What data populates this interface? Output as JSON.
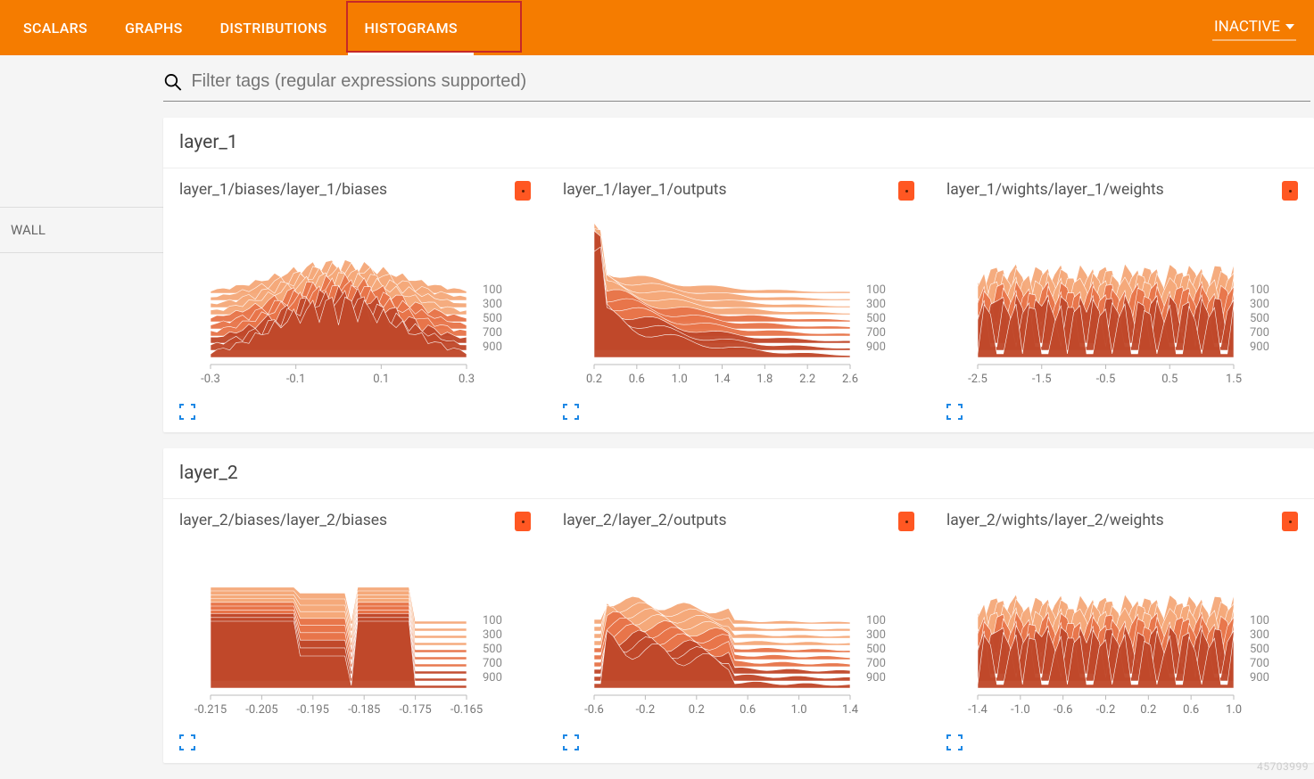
{
  "header": {
    "tabs": [
      "SCALARS",
      "GRAPHS",
      "DISTRIBUTIONS",
      "HISTOGRAMS"
    ],
    "active_tab": "HISTOGRAMS",
    "highlight_tab": "HISTOGRAMS",
    "dropdown_label": "INACTIVE"
  },
  "sidebar": {
    "item": "WALL"
  },
  "filter": {
    "placeholder": "Filter tags (regular expressions supported)"
  },
  "y_ticks": [
    100,
    300,
    500,
    700,
    900
  ],
  "groups": [
    {
      "name": "layer_1",
      "cards": [
        {
          "title": "layer_1/biases/layer_1/biases",
          "x_ticks": [
            "-0.3",
            "-0.1",
            "0.1",
            "0.3"
          ],
          "show_expand": true,
          "chart_data": {
            "type": "histogram",
            "steps": [
              100,
              300,
              500,
              700,
              900
            ],
            "x_range": [
              -0.4,
              0.4
            ],
            "shape": "gaussian_spikes"
          }
        },
        {
          "title": "layer_1/layer_1/outputs",
          "x_ticks": [
            "0.2",
            "0.6",
            "1.0",
            "1.4",
            "1.8",
            "2.2",
            "2.6"
          ],
          "show_expand": true,
          "chart_data": {
            "type": "histogram",
            "steps": [
              100,
              300,
              500,
              700,
              900
            ],
            "x_range": [
              0,
              2.8
            ],
            "shape": "decay"
          }
        },
        {
          "title": "layer_1/wights/layer_1/weights",
          "x_ticks": [
            "-2.5",
            "-1.5",
            "-0.5",
            "0.5",
            "1.5"
          ],
          "show_expand": true,
          "chart_data": {
            "type": "histogram",
            "steps": [
              100,
              300,
              500,
              700,
              900
            ],
            "x_range": [
              -3,
              2
            ],
            "shape": "spikes"
          }
        }
      ]
    },
    {
      "name": "layer_2",
      "cards": [
        {
          "title": "layer_2/biases/layer_2/biases",
          "x_ticks": [
            "-0.215",
            "-0.205",
            "-0.195",
            "-0.185",
            "-0.175",
            "-0.165"
          ],
          "show_expand": true,
          "chart_data": {
            "type": "histogram",
            "steps": [
              100,
              300,
              500,
              700,
              900
            ],
            "x_range": [
              -0.22,
              -0.16
            ],
            "shape": "blocks"
          }
        },
        {
          "title": "layer_2/layer_2/outputs",
          "x_ticks": [
            "-0.6",
            "-0.2",
            "0.2",
            "0.6",
            "1.0",
            "1.4"
          ],
          "show_expand": true,
          "chart_data": {
            "type": "histogram",
            "steps": [
              100,
              300,
              500,
              700,
              900
            ],
            "x_range": [
              -0.8,
              1.6
            ],
            "shape": "decay2"
          }
        },
        {
          "title": "layer_2/wights/layer_2/weights",
          "x_ticks": [
            "-1.4",
            "-1.0",
            "-0.6",
            "-0.2",
            "0.2",
            "0.6",
            "1.0"
          ],
          "show_expand": true,
          "chart_data": {
            "type": "histogram",
            "steps": [
              100,
              300,
              500,
              700,
              900
            ],
            "x_range": [
              -1.6,
              1.2
            ],
            "shape": "spikes"
          }
        }
      ]
    }
  ],
  "watermark": "45703999"
}
